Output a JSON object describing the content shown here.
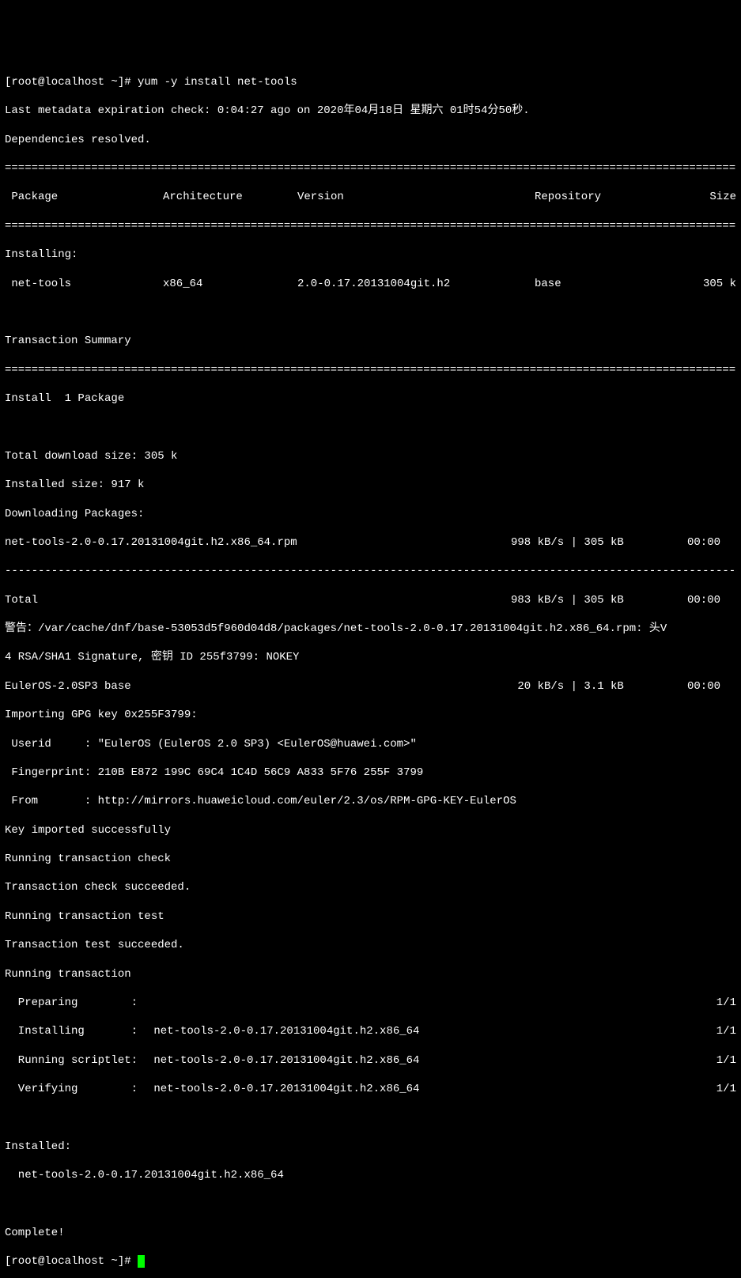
{
  "prompt1": "[root@localhost ~]# ",
  "cmd1": "yum -y install net-tools",
  "meta_line": "Last metadata expiration check: 0:04:27 ago on 2020年04月18日 星期六 01时54分50秒.",
  "deps_resolved": "Dependencies resolved.",
  "hr_eq": "==============================================================================================================",
  "hr_dash": "--------------------------------------------------------------------------------------------------------------",
  "hdr": {
    "pkg": " Package",
    "arch": "Architecture",
    "ver": "Version",
    "repo": "Repository",
    "size": "Size"
  },
  "section_installing": "Installing:",
  "row1": {
    "pkg": " net-tools",
    "arch": "x86_64",
    "ver": "2.0-0.17.20131004git.h2",
    "repo": "base",
    "size": "305 k"
  },
  "tx_summary": "Transaction Summary",
  "install_count": "Install  1 Package",
  "total_dl": "Total download size: 305 k",
  "installed_size": "Installed size: 917 k",
  "dl_pkgs": "Downloading Packages:",
  "dl1": {
    "name": "net-tools-2.0-0.17.20131004git.h2.x86_64.rpm",
    "rate": "998 kB/s | 305 kB",
    "time": "00:00"
  },
  "total": {
    "name": "Total",
    "rate": "983 kB/s | 305 kB",
    "time": "00:00"
  },
  "warn1": "警告：/var/cache/dnf/base-53053d5f960d04d8/packages/net-tools-2.0-0.17.20131004git.h2.x86_64.rpm: 头V",
  "warn2": "4 RSA/SHA1 Signature, 密钥 ID 255f3799: NOKEY",
  "euler": {
    "name": "EulerOS-2.0SP3 base",
    "rate": " 20 kB/s | 3.1 kB",
    "time": "00:00"
  },
  "gpg_import": "Importing GPG key 0x255F3799:",
  "gpg_userid": " Userid     : \"EulerOS (EulerOS 2.0 SP3) <EulerOS@huawei.com>\"",
  "gpg_fp": " Fingerprint: 210B E872 199C 69C4 1C4D 56C9 A833 5F76 255F 3799",
  "gpg_from": " From       : http://mirrors.huaweicloud.com/euler/2.3/os/RPM-GPG-KEY-EulerOS",
  "key_ok": "Key imported successfully",
  "tx_check": "Running transaction check",
  "tx_check_ok": "Transaction check succeeded.",
  "tx_test": "Running transaction test",
  "tx_test_ok": "Transaction test succeeded.",
  "tx_run": "Running transaction",
  "tx_prep": {
    "label": "  Preparing        :",
    "val": "",
    "count": "1/1"
  },
  "tx_install": {
    "label": "  Installing       :",
    "val": " net-tools-2.0-0.17.20131004git.h2.x86_64",
    "count": "1/1"
  },
  "tx_script": {
    "label": "  Running scriptlet:",
    "val": " net-tools-2.0-0.17.20131004git.h2.x86_64",
    "count": "1/1"
  },
  "tx_verify": {
    "label": "  Verifying        :",
    "val": " net-tools-2.0-0.17.20131004git.h2.x86_64",
    "count": "1/1"
  },
  "installed_hdr": "Installed:",
  "installed_pkg": "  net-tools-2.0-0.17.20131004git.h2.x86_64",
  "complete": "Complete!",
  "prompt2": "[root@localhost ~]# "
}
